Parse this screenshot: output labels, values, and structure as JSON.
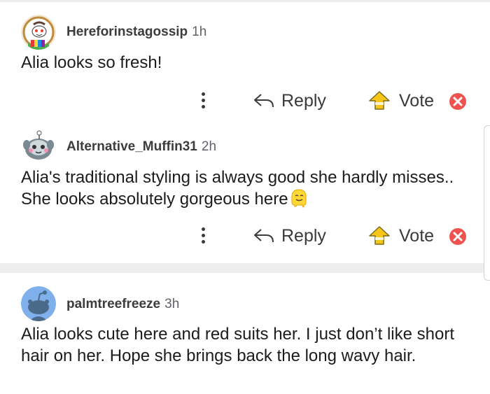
{
  "comments": [
    {
      "author": "Hereforinstagossip",
      "time": "1h",
      "text": "Alia looks so fresh!",
      "avatar_icon": "snoo-avatar-icon",
      "emoji": ""
    },
    {
      "author": "Alternative_Muffin31",
      "time": "2h",
      "text": "Alia's traditional styling is always good she hardly misses.. She looks absolutely gorgeous here",
      "avatar_icon": "snoo-avatar-icon",
      "emoji": "melting-face-emoji"
    },
    {
      "author": "palmtreefreeze",
      "time": "3h",
      "text": "Alia looks cute here and red suits her. I just don’t like short hair on her. Hope she brings back the long wavy hair.",
      "avatar_icon": "default-snoo-icon",
      "emoji": ""
    }
  ],
  "actions": {
    "reply_label": "Reply",
    "vote_label": "Vote",
    "more_icon": "more-vertical-icon",
    "reply_icon": "reply-arrow-icon",
    "upvote_icon": "upvote-icon",
    "downvote_icon": "downvote-icon"
  },
  "colors": {
    "upvote_accent": "#f5c518",
    "downvote_accent": "#ef5350",
    "default_avatar_bg": "#7fb0ec"
  }
}
